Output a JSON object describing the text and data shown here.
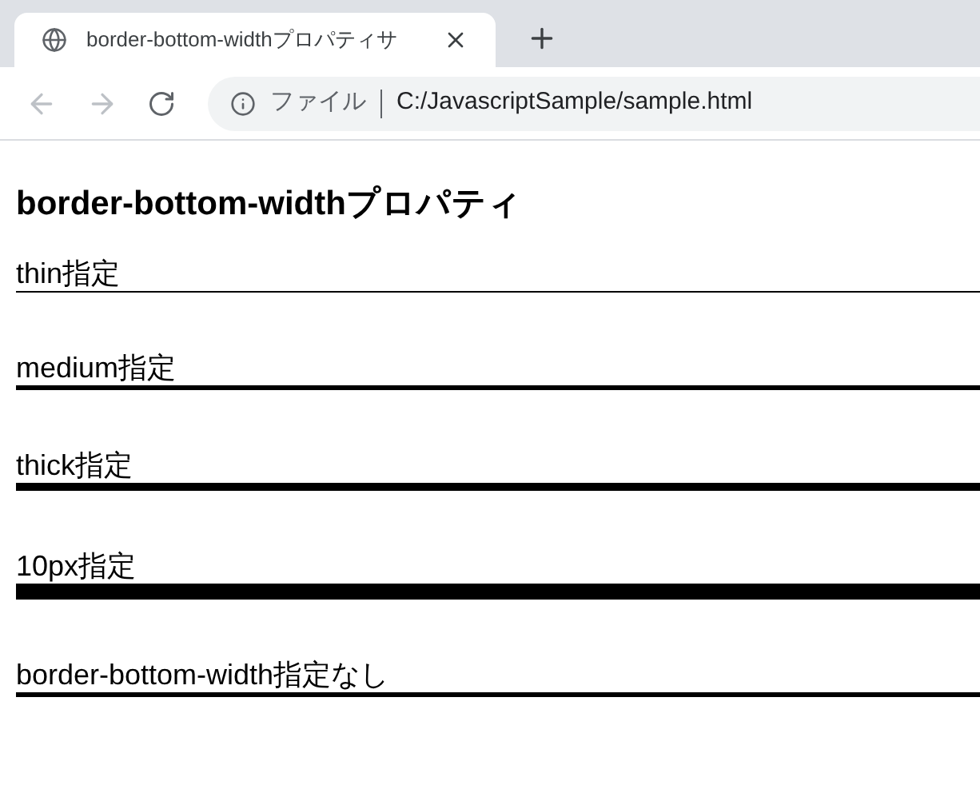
{
  "tab": {
    "title": "border-bottom-widthプロパティサ",
    "selected": true
  },
  "address": {
    "scheme": "ファイル",
    "url": "C:/JavascriptSample/sample.html"
  },
  "heading": "border-bottom-widthプロパティ",
  "items": [
    {
      "text": "thin指定",
      "kind": "thin"
    },
    {
      "text": "medium指定",
      "kind": "medium"
    },
    {
      "text": "thick指定",
      "kind": "thick"
    },
    {
      "text": "10px指定",
      "kind": "px10"
    },
    {
      "text": "border-bottom-width指定なし",
      "kind": "default"
    }
  ]
}
